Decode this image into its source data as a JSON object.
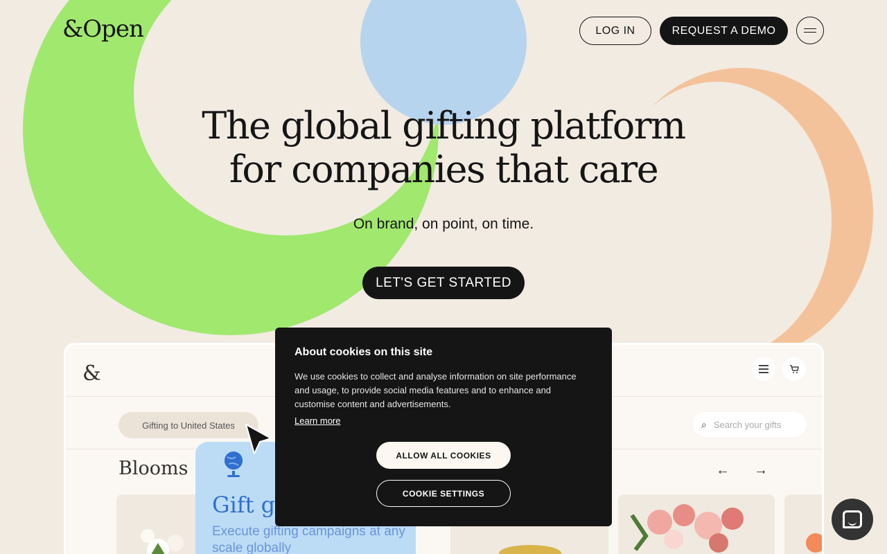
{
  "colors": {
    "background": "#f1ebe2",
    "green_shape": "#a0e86e",
    "blue_shape": "#b7d4ee",
    "peach_shape": "#f4c29a",
    "primary_dark": "#151515",
    "feature_blue": "#2f6fcf"
  },
  "header": {
    "logo": "&Open",
    "login_label": "LOG IN",
    "demo_label": "REQUEST A DEMO",
    "menu_icon": "hamburger-icon"
  },
  "hero": {
    "title_line1": "The global gifting platform",
    "title_line2": "for companies that care",
    "subtitle": "On brand, on point, on time.",
    "cta_label": "LET'S GET STARTED"
  },
  "preview": {
    "logo": "&",
    "icons": [
      "menu-icon",
      "cart-icon"
    ],
    "location_chip": "Gifting to United States",
    "search_placeholder": "Search your gifts",
    "section_heading": "Blooms",
    "feature": {
      "title": "Gift glo",
      "body": "Execute gifting campaigns at any scale globally"
    }
  },
  "cookie_banner": {
    "title": "About cookies on this site",
    "body": "We use cookies to collect and analyse information on site performance and usage, to provide social media features and to enhance and customise content and advertisements.",
    "learn_more": "Learn more",
    "allow_label": "ALLOW ALL COOKIES",
    "settings_label": "COOKIE SETTINGS"
  },
  "chat": {
    "icon": "chat-icon"
  }
}
